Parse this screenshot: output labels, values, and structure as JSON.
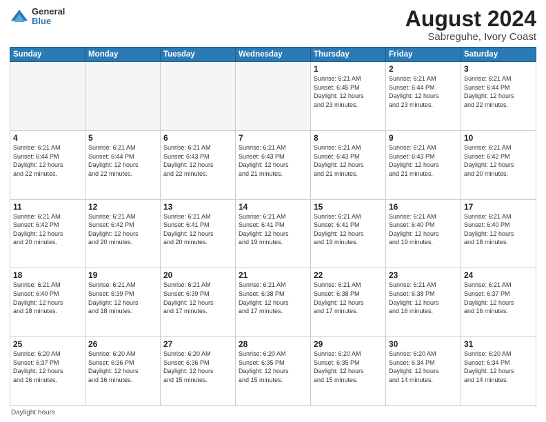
{
  "header": {
    "logo_line1": "General",
    "logo_line2": "Blue",
    "title": "August 2024",
    "subtitle": "Sabreguhe, Ivory Coast"
  },
  "days_of_week": [
    "Sunday",
    "Monday",
    "Tuesday",
    "Wednesday",
    "Thursday",
    "Friday",
    "Saturday"
  ],
  "weeks": [
    [
      {
        "day": "",
        "info": ""
      },
      {
        "day": "",
        "info": ""
      },
      {
        "day": "",
        "info": ""
      },
      {
        "day": "",
        "info": ""
      },
      {
        "day": "1",
        "info": "Sunrise: 6:21 AM\nSunset: 6:45 PM\nDaylight: 12 hours\nand 23 minutes."
      },
      {
        "day": "2",
        "info": "Sunrise: 6:21 AM\nSunset: 6:44 PM\nDaylight: 12 hours\nand 23 minutes."
      },
      {
        "day": "3",
        "info": "Sunrise: 6:21 AM\nSunset: 6:44 PM\nDaylight: 12 hours\nand 22 minutes."
      }
    ],
    [
      {
        "day": "4",
        "info": "Sunrise: 6:21 AM\nSunset: 6:44 PM\nDaylight: 12 hours\nand 22 minutes."
      },
      {
        "day": "5",
        "info": "Sunrise: 6:21 AM\nSunset: 6:44 PM\nDaylight: 12 hours\nand 22 minutes."
      },
      {
        "day": "6",
        "info": "Sunrise: 6:21 AM\nSunset: 6:43 PM\nDaylight: 12 hours\nand 22 minutes."
      },
      {
        "day": "7",
        "info": "Sunrise: 6:21 AM\nSunset: 6:43 PM\nDaylight: 12 hours\nand 21 minutes."
      },
      {
        "day": "8",
        "info": "Sunrise: 6:21 AM\nSunset: 6:43 PM\nDaylight: 12 hours\nand 21 minutes."
      },
      {
        "day": "9",
        "info": "Sunrise: 6:21 AM\nSunset: 6:43 PM\nDaylight: 12 hours\nand 21 minutes."
      },
      {
        "day": "10",
        "info": "Sunrise: 6:21 AM\nSunset: 6:42 PM\nDaylight: 12 hours\nand 20 minutes."
      }
    ],
    [
      {
        "day": "11",
        "info": "Sunrise: 6:21 AM\nSunset: 6:42 PM\nDaylight: 12 hours\nand 20 minutes."
      },
      {
        "day": "12",
        "info": "Sunrise: 6:21 AM\nSunset: 6:42 PM\nDaylight: 12 hours\nand 20 minutes."
      },
      {
        "day": "13",
        "info": "Sunrise: 6:21 AM\nSunset: 6:41 PM\nDaylight: 12 hours\nand 20 minutes."
      },
      {
        "day": "14",
        "info": "Sunrise: 6:21 AM\nSunset: 6:41 PM\nDaylight: 12 hours\nand 19 minutes."
      },
      {
        "day": "15",
        "info": "Sunrise: 6:21 AM\nSunset: 6:41 PM\nDaylight: 12 hours\nand 19 minutes."
      },
      {
        "day": "16",
        "info": "Sunrise: 6:21 AM\nSunset: 6:40 PM\nDaylight: 12 hours\nand 19 minutes."
      },
      {
        "day": "17",
        "info": "Sunrise: 6:21 AM\nSunset: 6:40 PM\nDaylight: 12 hours\nand 18 minutes."
      }
    ],
    [
      {
        "day": "18",
        "info": "Sunrise: 6:21 AM\nSunset: 6:40 PM\nDaylight: 12 hours\nand 18 minutes."
      },
      {
        "day": "19",
        "info": "Sunrise: 6:21 AM\nSunset: 6:39 PM\nDaylight: 12 hours\nand 18 minutes."
      },
      {
        "day": "20",
        "info": "Sunrise: 6:21 AM\nSunset: 6:39 PM\nDaylight: 12 hours\nand 17 minutes."
      },
      {
        "day": "21",
        "info": "Sunrise: 6:21 AM\nSunset: 6:38 PM\nDaylight: 12 hours\nand 17 minutes."
      },
      {
        "day": "22",
        "info": "Sunrise: 6:21 AM\nSunset: 6:38 PM\nDaylight: 12 hours\nand 17 minutes."
      },
      {
        "day": "23",
        "info": "Sunrise: 6:21 AM\nSunset: 6:38 PM\nDaylight: 12 hours\nand 16 minutes."
      },
      {
        "day": "24",
        "info": "Sunrise: 6:21 AM\nSunset: 6:37 PM\nDaylight: 12 hours\nand 16 minutes."
      }
    ],
    [
      {
        "day": "25",
        "info": "Sunrise: 6:20 AM\nSunset: 6:37 PM\nDaylight: 12 hours\nand 16 minutes."
      },
      {
        "day": "26",
        "info": "Sunrise: 6:20 AM\nSunset: 6:36 PM\nDaylight: 12 hours\nand 16 minutes."
      },
      {
        "day": "27",
        "info": "Sunrise: 6:20 AM\nSunset: 6:36 PM\nDaylight: 12 hours\nand 15 minutes."
      },
      {
        "day": "28",
        "info": "Sunrise: 6:20 AM\nSunset: 6:35 PM\nDaylight: 12 hours\nand 15 minutes."
      },
      {
        "day": "29",
        "info": "Sunrise: 6:20 AM\nSunset: 6:35 PM\nDaylight: 12 hours\nand 15 minutes."
      },
      {
        "day": "30",
        "info": "Sunrise: 6:20 AM\nSunset: 6:34 PM\nDaylight: 12 hours\nand 14 minutes."
      },
      {
        "day": "31",
        "info": "Sunrise: 6:20 AM\nSunset: 6:34 PM\nDaylight: 12 hours\nand 14 minutes."
      }
    ]
  ],
  "footer": "Daylight hours"
}
